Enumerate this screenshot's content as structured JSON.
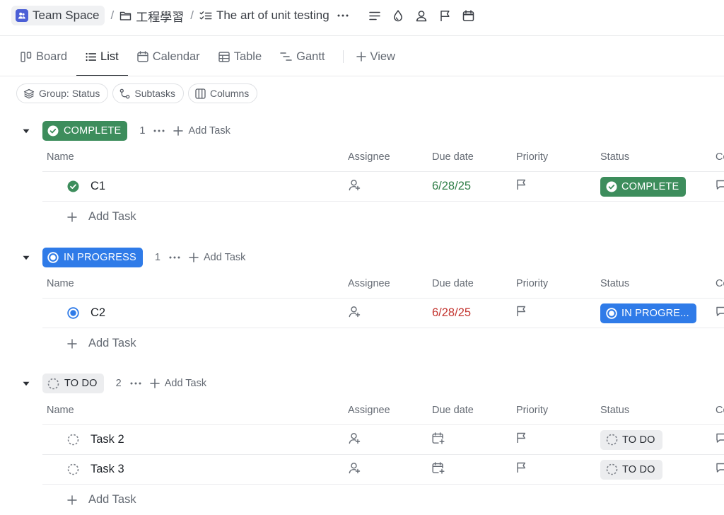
{
  "breadcrumb": {
    "space": "Team Space",
    "folder": "工程學習",
    "list": "The art of unit testing"
  },
  "tabs": [
    {
      "label": "Board",
      "active": false
    },
    {
      "label": "List",
      "active": true
    },
    {
      "label": "Calendar",
      "active": false
    },
    {
      "label": "Table",
      "active": false
    },
    {
      "label": "Gantt",
      "active": false
    }
  ],
  "view_button": "View",
  "chips": {
    "group": "Group: Status",
    "subtasks": "Subtasks",
    "columns": "Columns"
  },
  "columns": {
    "name": "Name",
    "assignee": "Assignee",
    "due": "Due date",
    "priority": "Priority",
    "status": "Status",
    "cut": "Co"
  },
  "add_task": "Add Task",
  "groups": [
    {
      "status": "COMPLETE",
      "count": "1",
      "tasks": [
        {
          "name": "C1",
          "due": "6/28/25",
          "status": "COMPLETE"
        }
      ]
    },
    {
      "status": "IN PROGRESS",
      "count": "1",
      "tasks": [
        {
          "name": "C2",
          "due": "6/28/25",
          "status": "IN PROGRE..."
        }
      ]
    },
    {
      "status": "TO DO",
      "count": "2",
      "tasks": [
        {
          "name": "Task 2",
          "due": "",
          "status": "TO DO"
        },
        {
          "name": "Task 3",
          "due": "",
          "status": "TO DO"
        }
      ]
    }
  ],
  "colors": {
    "complete": "#3d8d5c",
    "in_progress": "#2f7be8",
    "todo_bg": "#ecedef",
    "overdue": "#c3342f",
    "due_ok": "#2e7d47"
  }
}
